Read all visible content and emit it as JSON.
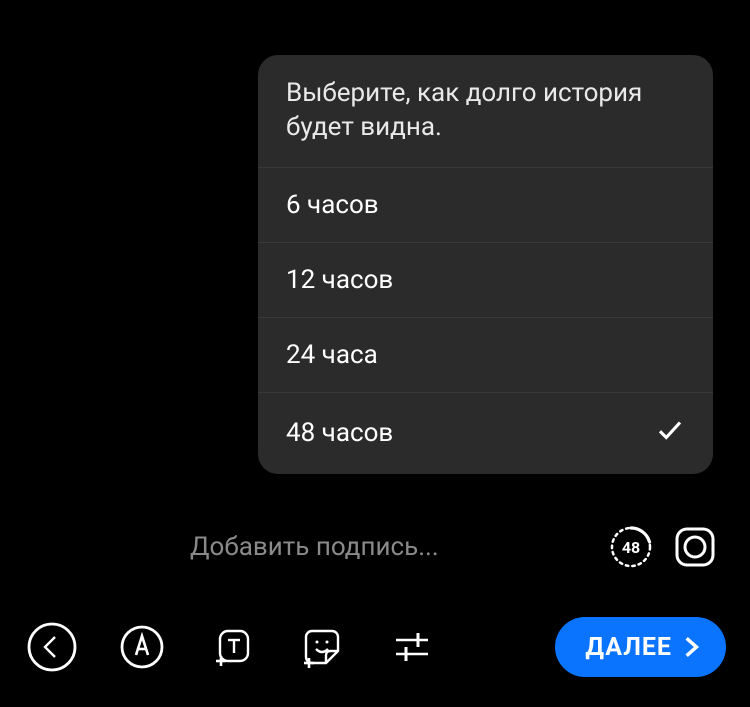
{
  "popover": {
    "title": "Выберите, как долго история будет видна.",
    "options": [
      {
        "label": "6 часов",
        "selected": false
      },
      {
        "label": "12 часов",
        "selected": false
      },
      {
        "label": "24 часа",
        "selected": false
      },
      {
        "label": "48 часов",
        "selected": true
      }
    ]
  },
  "caption": {
    "placeholder": "Добавить подпись...",
    "value": "",
    "timer_value": "48"
  },
  "toolbar": {
    "next_label": "ДАЛЕЕ"
  }
}
